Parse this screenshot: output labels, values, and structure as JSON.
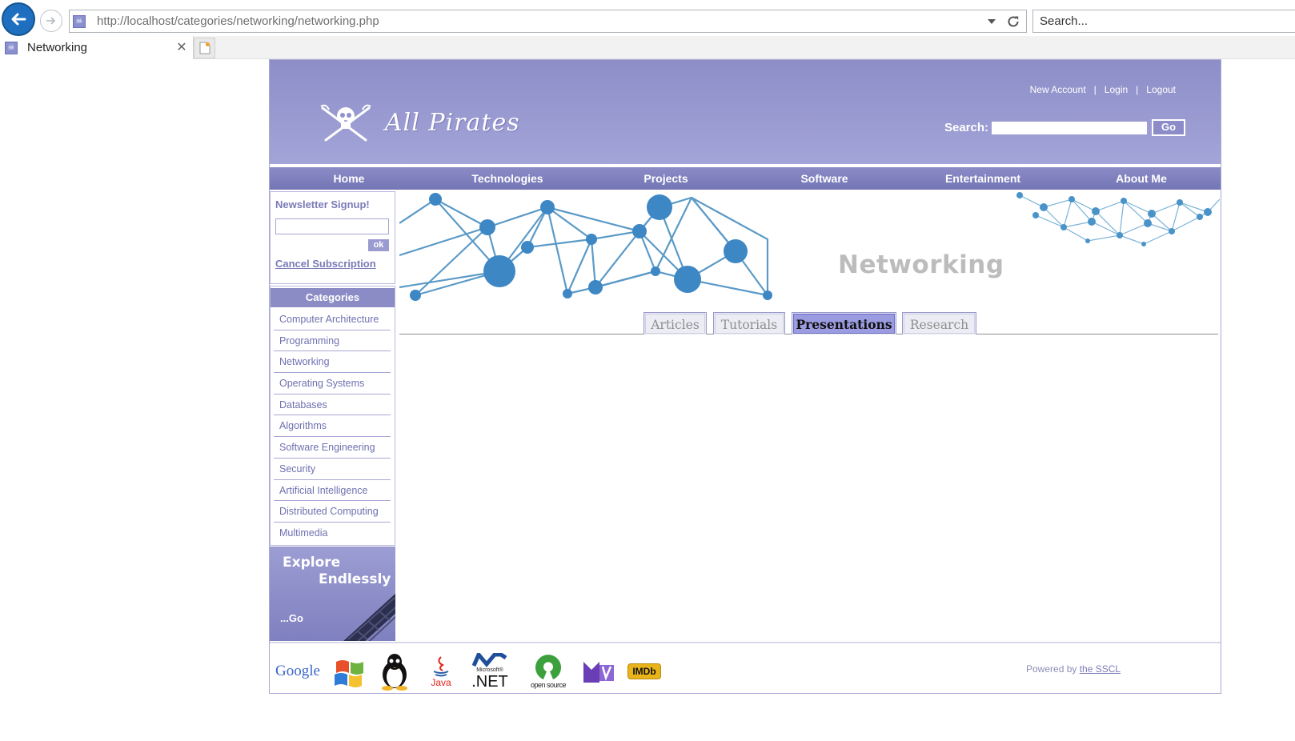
{
  "browser": {
    "address": "http://localhost/categories/networking/networking.php",
    "search_placeholder": "Search...",
    "tab_title": "Networking",
    "tab_close": "✕"
  },
  "site": {
    "logo_text": "All Pirates",
    "account_links": [
      "New Account",
      "Login",
      "Logout"
    ],
    "search_label": "Search:",
    "search_button": "Go",
    "nav": [
      "Home",
      "Technologies",
      "Projects",
      "Software",
      "Entertainment",
      "About Me"
    ]
  },
  "sidebar": {
    "newsletter_title": "Newsletter Signup!",
    "newsletter_ok": "ok",
    "cancel_subscription": "Cancel Subscription",
    "categories_title": "Categories",
    "categories": [
      "Computer Architecture",
      "Programming",
      "Networking",
      "Operating Systems",
      "Databases",
      "Algorithms",
      "Software Engineering",
      "Security",
      "Artificial Intelligence",
      "Distributed Computing",
      "Multimedia"
    ],
    "explore_line1": "Explore",
    "explore_line2": "Endlessly",
    "explore_go": "...Go"
  },
  "main": {
    "banner_title": "Networking",
    "tabs": [
      {
        "label": "Articles",
        "active": false
      },
      {
        "label": "Tutorials",
        "active": false
      },
      {
        "label": "Presentations",
        "active": true
      },
      {
        "label": "Research",
        "active": false
      }
    ]
  },
  "footer": {
    "logos": [
      "google-logo",
      "windows-logo",
      "linux-tux-logo",
      "java-logo",
      "dotnet-logo",
      "open-source-logo",
      "mtv-logo",
      "imdb-logo"
    ],
    "logo_text": {
      "google": "Google",
      "java": "Java",
      "dotnet_small": "Microsoft®",
      "dotnet": ".NET",
      "open_source": "open source",
      "imdb": "IMDb"
    },
    "powered_prefix": "Powered by",
    "powered_link": "the SSCL"
  },
  "colors": {
    "brand": "#8b8cc6",
    "link": "#7a7bb8",
    "active_tab": "#9a9be0"
  }
}
